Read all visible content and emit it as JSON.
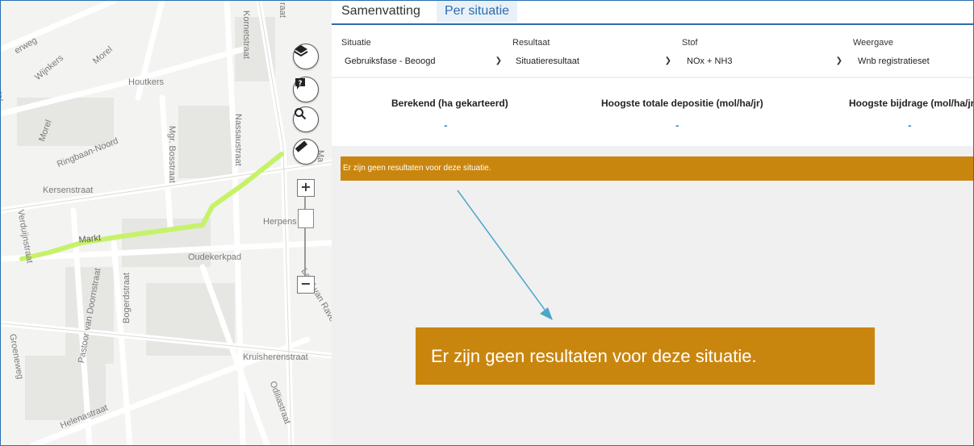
{
  "tabs": [
    {
      "label": "Samenvatting"
    },
    {
      "label": "Per situatie"
    }
  ],
  "filters": {
    "situatie": {
      "label": "Situatie",
      "value": "Gebruiksfase - Beoogd"
    },
    "resultaat": {
      "label": "Resultaat",
      "value": "Situatieresultaat"
    },
    "stof": {
      "label": "Stof",
      "value": "NOx + NH3"
    },
    "weergave": {
      "label": "Weergave",
      "value": "Wnb registratieset"
    }
  },
  "stats": [
    {
      "label": "Berekend (ha gekarteerd)",
      "value": "-"
    },
    {
      "label": "Hoogste totale depositie (mol/ha/jr)",
      "value": "-"
    },
    {
      "label": "Hoogste bijdrage (mol/ha/jr)",
      "value": "-"
    }
  ],
  "message": "Er zijn geen resultaten voor deze situatie.",
  "callout": "Er zijn geen resultaten voor deze situatie.",
  "map": {
    "streets": {
      "erweg": "erweg",
      "wijnkers": "Wijnkers",
      "morel_top": "Morel",
      "houtkers": "Houtkers",
      "morel_left": "Morel",
      "ringbaan": "Ringbaan-Noord",
      "mgr_bosstraat": "Mgr. Bosstraat",
      "nassaustraat": "Nassaustraat",
      "kersenstraat": "Kersenstraat",
      "verduijnstraat": "Verduijnstraat",
      "herpens": "Herpens",
      "oudekerkpad": "Oudekerkpad",
      "kornetstraat": "Kornetstraat",
      "pastoor": "Pastoor van Doornstraat",
      "bogerdstraat": "Bogerdstraat",
      "land_van_ravens": "Land van Rave",
      "kruisherenstraat": "Kruisherenstraat",
      "groeneweg": "Groeneweg",
      "helenastraat": "Helenastraat",
      "odiliastraat": "Odiliastraat",
      "markt": "Markt",
      "raat": "raat",
      "rel": "rel",
      "ma": "Ma"
    },
    "zoom_in": "+",
    "zoom_out": "−"
  },
  "colors": {
    "accent": "#2b6cb0",
    "banner": "#c9860f",
    "route": "#c6f26a",
    "arrow": "#4aa7c9"
  }
}
